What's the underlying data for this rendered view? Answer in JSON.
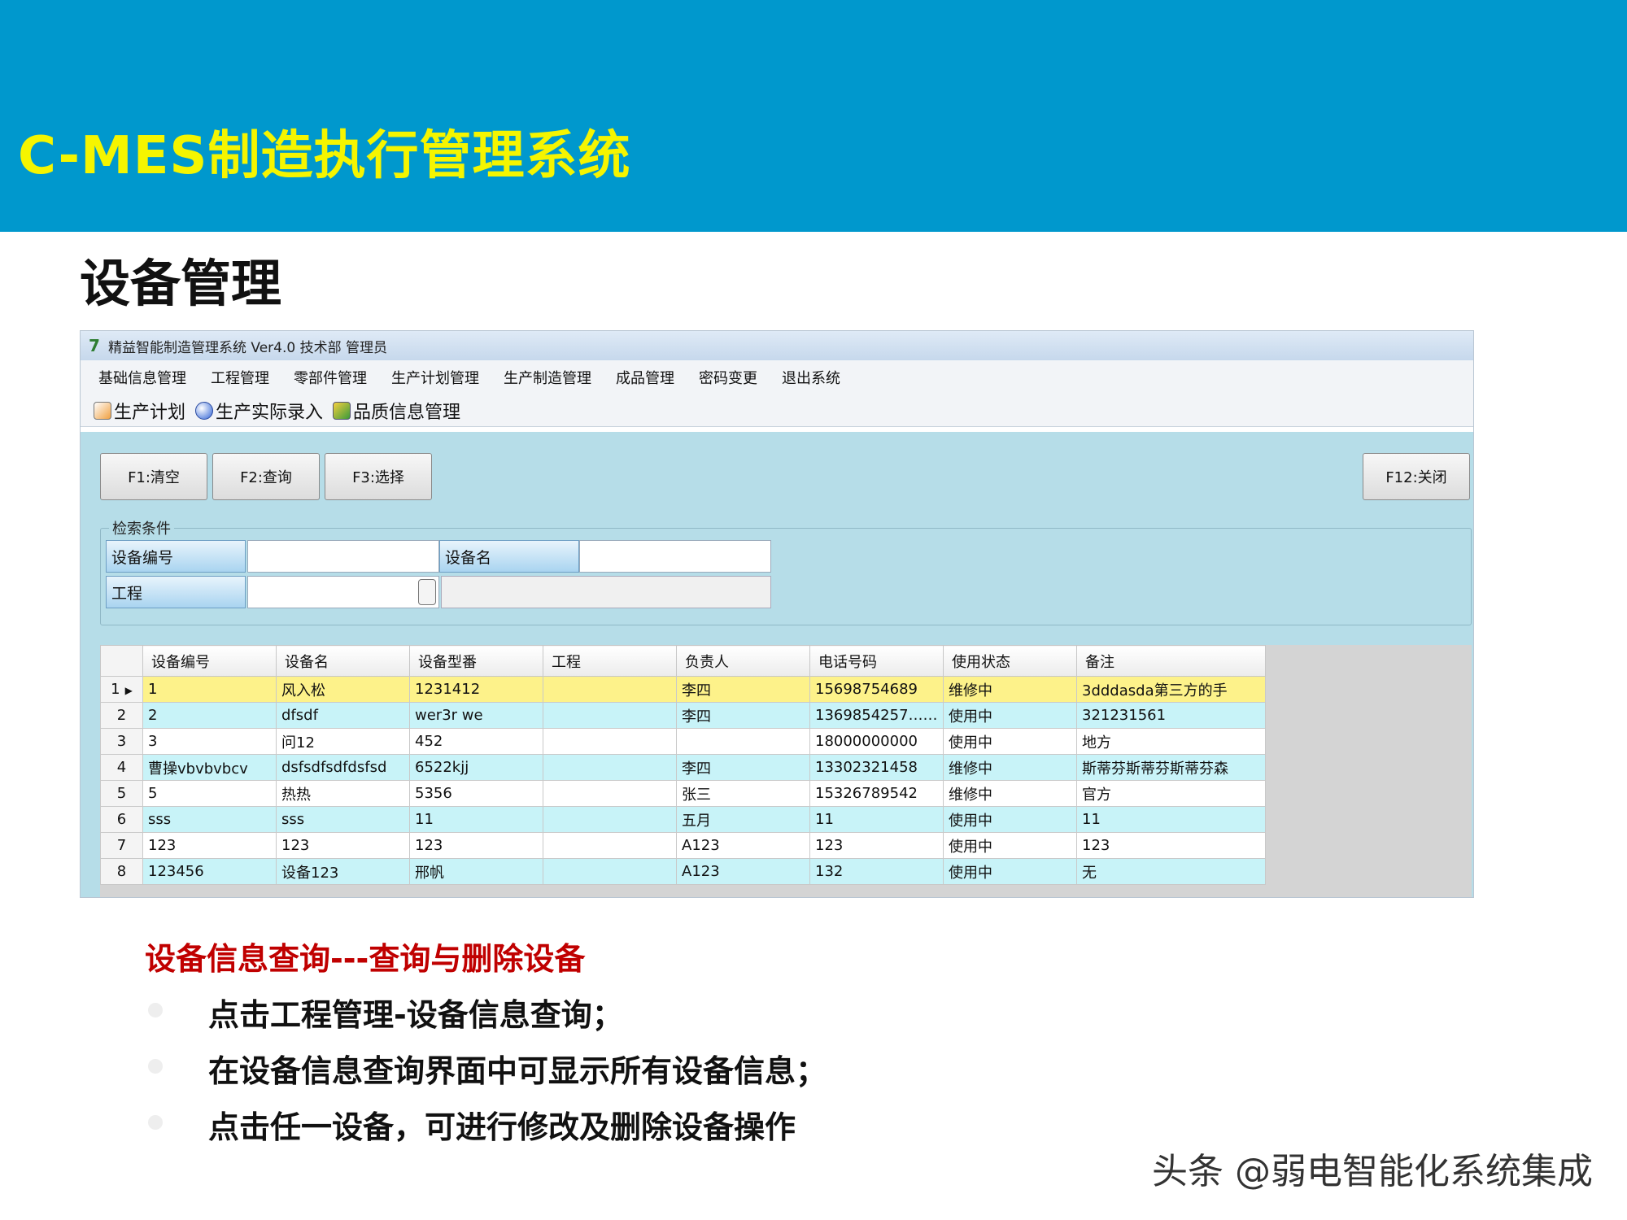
{
  "slide": {
    "title": "C-MES制造执行管理系统",
    "section": "设备管理",
    "footer": "头条 @弱电智能化系统集成"
  },
  "window": {
    "title": "精益智能制造管理系统 Ver4.0 技术部 管理员"
  },
  "menu": [
    "基础信息管理",
    "工程管理",
    "零部件管理",
    "生产计划管理",
    "生产制造管理",
    "成品管理",
    "密码变更",
    "退出系统"
  ],
  "toolbar": [
    "生产计划",
    "生产实际录入",
    "品质信息管理"
  ],
  "buttons": {
    "clear": "F1:清空",
    "query": "F2:查询",
    "select": "F3:选择",
    "close": "F12:关闭"
  },
  "search": {
    "group_label": "检索条件",
    "device_no_label": "设备编号",
    "device_no_value": "",
    "device_name_label": "设备名",
    "device_name_value": "",
    "project_label": "工程",
    "project_value": ""
  },
  "grid": {
    "columns": [
      "设备编号",
      "设备名",
      "设备型番",
      "工程",
      "负责人",
      "电话号码",
      "使用状态",
      "备注"
    ],
    "rows": [
      [
        "1",
        "风入松",
        "1231412",
        "",
        "李四",
        "15698754689",
        "维修中",
        "3dddasda第三方的手"
      ],
      [
        "2",
        "dfsdf",
        "wer3r we",
        "",
        "李四",
        "1369854257……",
        "使用中",
        "321231561"
      ],
      [
        "3",
        "问12",
        "452",
        "",
        "",
        "18000000000",
        "使用中",
        "地方"
      ],
      [
        "曹操vbvbvbcv",
        "dsfsdfsdfdsfsd",
        "6522kjj",
        "",
        "李四",
        "13302321458",
        "维修中",
        "斯蒂芬斯蒂芬斯蒂芬森"
      ],
      [
        "5",
        "热热",
        "5356",
        "",
        "张三",
        "15326789542",
        "维修中",
        "官方"
      ],
      [
        "sss",
        "sss",
        "11",
        "",
        "五月",
        "11",
        "使用中",
        "11"
      ],
      [
        "123",
        "123",
        "123",
        "",
        "A123",
        "123",
        "使用中",
        "123"
      ],
      [
        "123456",
        "设备123",
        "邢帆",
        "",
        "A123",
        "132",
        "使用中",
        "无"
      ]
    ],
    "row_numbers": [
      "1",
      "2",
      "3",
      "4",
      "5",
      "6",
      "7",
      "8"
    ],
    "selected_row_index": 0
  },
  "bullets": {
    "heading": "设备信息查询---查询与删除设备",
    "items": [
      "点击工程管理-设备信息查询；",
      "在设备信息查询界面中可显示所有设备信息；",
      "点击任一设备，可进行修改及删除设备操作"
    ]
  },
  "colors": {
    "banner": "#0098cd",
    "title": "#f5f500",
    "heading_red": "#c00000",
    "selected_row": "#fdf28a",
    "alt_row": "#c8f3f8"
  }
}
